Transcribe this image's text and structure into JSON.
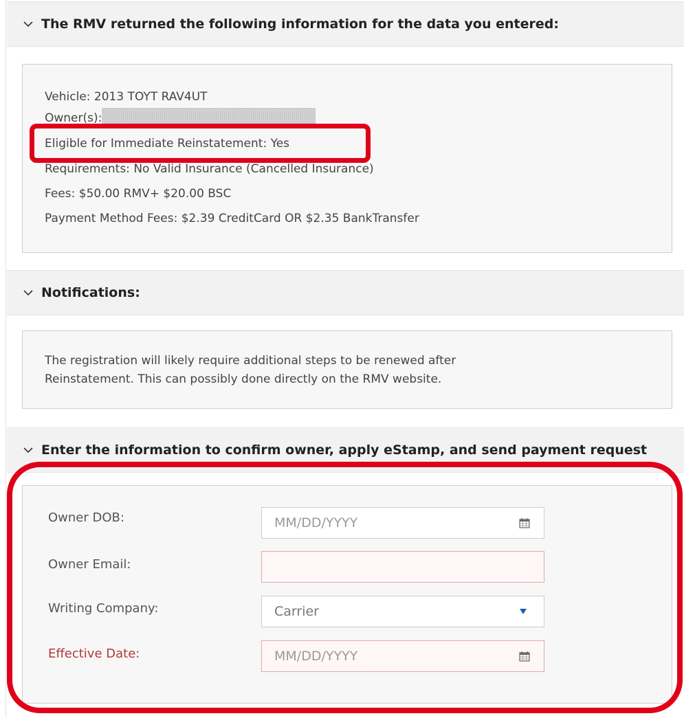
{
  "rmv_section": {
    "title": "The RMV returned the following information for the data you entered:",
    "lines": {
      "vehicle": "Vehicle: 2013 TOYT RAV4UT",
      "owners_label": "Owner(s):",
      "eligible": "Eligible for Immediate Reinstatement: Yes",
      "requirements": "Requirements: No Valid Insurance (Cancelled Insurance)",
      "fees": "Fees: $50.00 RMV+ $20.00 BSC",
      "payment_fees": "Payment Method Fees: $2.39 CreditCard OR $2.35 BankTransfer"
    }
  },
  "notifications_section": {
    "title": "Notifications:",
    "text_line1": "The registration will likely require additional steps to be renewed after",
    "text_line2": "Reinstatement. This can possibly done directly on the RMV website."
  },
  "form_section": {
    "title": "Enter the information to confirm owner, apply eStamp, and send payment request",
    "owner_dob": {
      "label": "Owner DOB:",
      "placeholder": "MM/DD/YYYY",
      "value": ""
    },
    "owner_email": {
      "label": "Owner Email:",
      "value": ""
    },
    "writing_company": {
      "label": "Writing Company:",
      "selected": "Carrier"
    },
    "effective_date": {
      "label": "Effective Date:",
      "placeholder": "MM/DD/YYYY",
      "value": ""
    }
  },
  "icons": {
    "chevron": "chevron-down-icon",
    "calendar": "calendar-icon",
    "dropdown": "caret-down-icon"
  },
  "colors": {
    "highlight": "#e0001a",
    "required_label": "#b23a3a",
    "dropdown_arrow": "#1f5f9e"
  }
}
